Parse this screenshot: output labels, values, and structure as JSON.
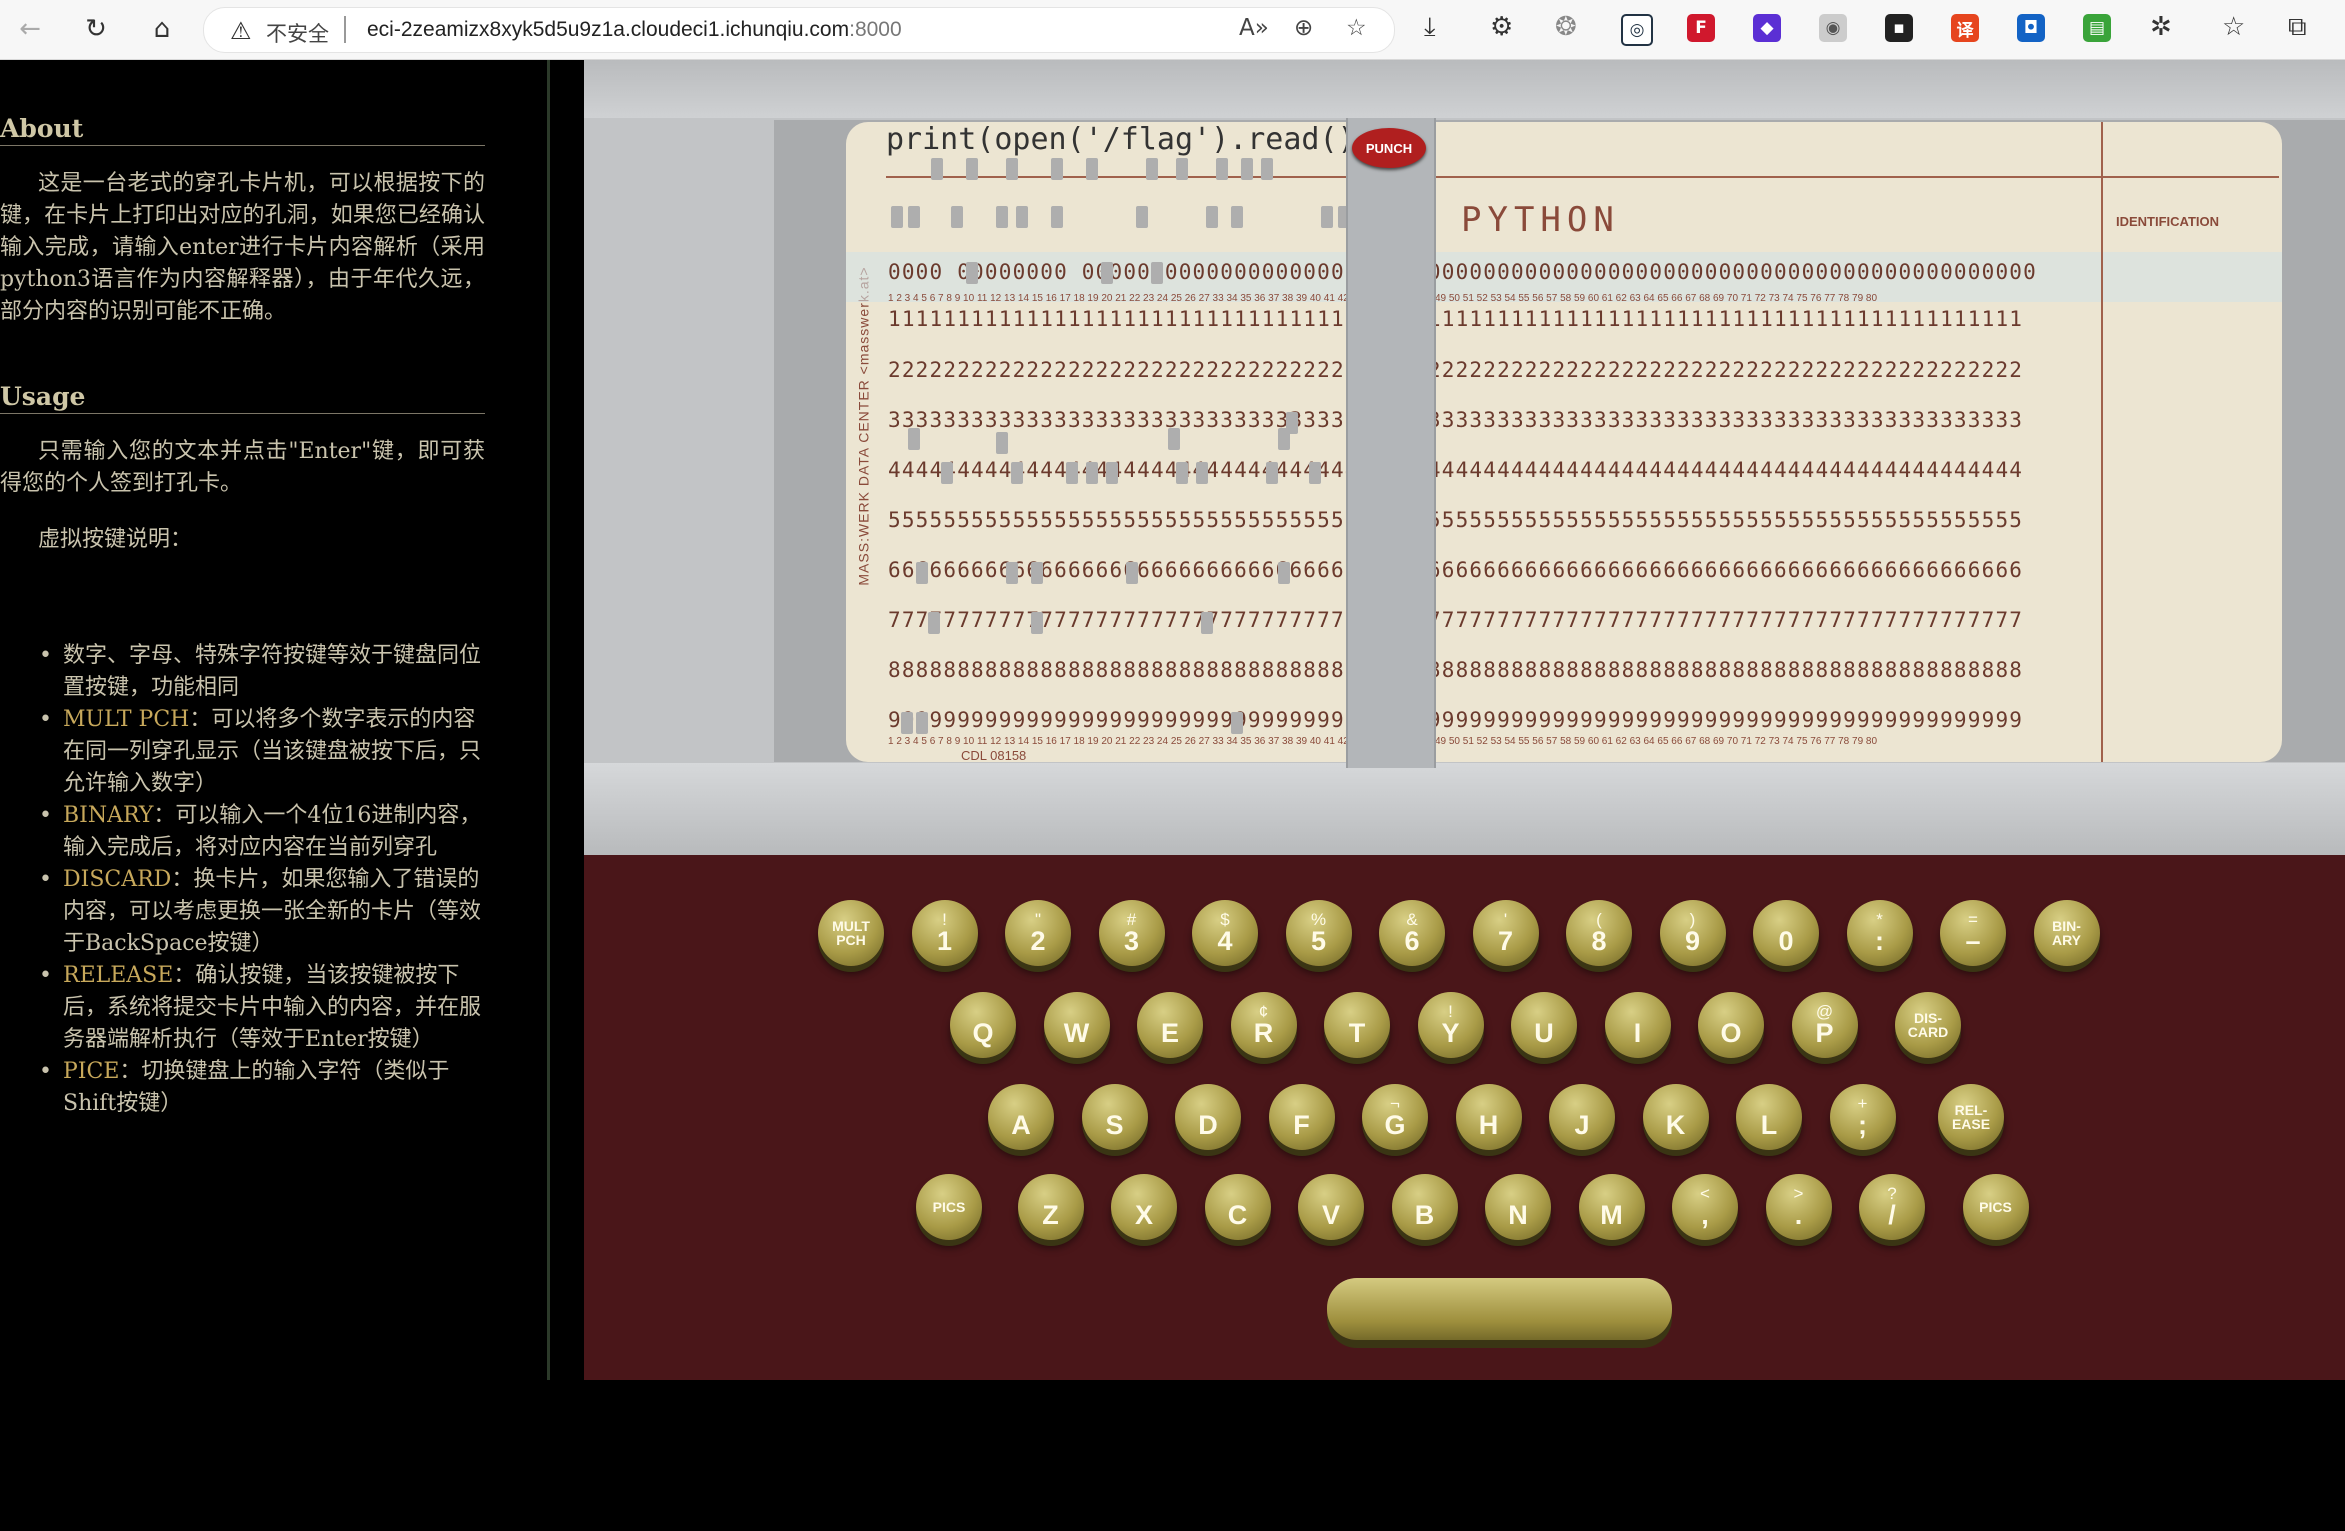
{
  "browser": {
    "security_label": "不安全",
    "url_host": "eci-2zeamizx8xyk5d5u9z1a.cloudeci1.ichunqiu.com",
    "url_port": ":8000",
    "icons": [
      "back-icon",
      "refresh-icon",
      "home-icon",
      "warning-icon",
      "read-aloud-icon",
      "zoom-icon",
      "favorite-add-icon",
      "download-icon",
      "extension-icon",
      "collections-icon",
      "favorites-icon",
      "split-screen-icon"
    ]
  },
  "sidebar": {
    "about_title": "About",
    "about_text": "这是一台老式的穿孔卡片机，可以根据按下的键，在卡片上打印出对应的孔洞，如果您已经确认输入完成，请输入enter进行卡片内容解析（采用python3语言作为内容解释器），由于年代久远，部分内容的识别可能不正确。",
    "usage_title": "Usage",
    "usage_text": "只需输入您的文本并点击\"Enter\"键，即可获得您的个人签到打孔卡。",
    "keys_intro": "虚拟按键说明：",
    "items": [
      {
        "keyword": "",
        "text": "数字、字母、特殊字符按键等效于键盘同位置按键，功能相同"
      },
      {
        "keyword": "MULT PCH",
        "text": "：可以将多个数字表示的内容在同一列穿孔显示（当该键盘被按下后，只允许输入数字）"
      },
      {
        "keyword": "BINARY",
        "text": "：可以输入一个4位16进制内容，输入完成后，将对应内容在当前列穿孔"
      },
      {
        "keyword": "DISCARD",
        "text": "：换卡片，如果您输入了错误的内容，可以考虑更换一张全新的卡片（等效于BackSpace按键）"
      },
      {
        "keyword": "RELEASE",
        "text": "：确认按键，当该按键被按下后，系统将提交卡片中输入的内容，并在服务器端解析执行（等效于Enter按键）"
      },
      {
        "keyword": "PICE",
        "text": "：切换键盘上的输入字符（类似于Shift按键）"
      }
    ]
  },
  "card": {
    "printed_text": "print(open('/flag').read())",
    "language_label": "PYTHON",
    "identification_label": "IDENTIFICATION",
    "side_label": "MASS:WERK DATA CENTER  <masswerk.at>",
    "footer_label": "CDL   08158",
    "punch_button": "PUNCH",
    "digit_rows": [
      "0000 00000000 000000000000000000000000000000000000000000000000000000000000000000000",
      "1111111111111111111111111111111111111111111111111111111111111111111111111111111111",
      "2222222222222222222222222222222222222222222222222222222222222222222222222222222222",
      "3333333333333333333333333333333333333333333333333333333333333333333333333333333333",
      "4444444444444444444444444444444444444444444444444444444444444444444444444444444444",
      "5555555555555555555555555555555555555555555555555555555555555555555555555555555555",
      "6666666666666666666666666666666666666666666666666666666666666666666666666666666666",
      "7777777777777777777777777777777777777777777777777777777777777777777777777777777777",
      "8888888888888888888888888888888888888888888888888888888888888888888888888888888888",
      "9999999999999999999999999999999999999999999999999999999999999999999999999999999999"
    ],
    "column_numbers": "1 2 3 4 5 6 7 8 9 10 11 12 13 14 15 16 17 18 19 20 21 22 23 24 25 26 27   33 34 35 36 37 38 39 40 41 42 43 44 45 46 47 48 49 50 51 52 53 54 55 56 57 58 59 60 61 62 63 64 65 66 67 68 69 70 71 72 73 74 75 76 77 78 79 80"
  },
  "keyboard": {
    "row1": [
      {
        "top": "MULT",
        "main": "PCH",
        "small": true
      },
      {
        "top": "!",
        "main": "1"
      },
      {
        "top": "\"",
        "main": "2"
      },
      {
        "top": "#",
        "main": "3"
      },
      {
        "top": "$",
        "main": "4"
      },
      {
        "top": "%",
        "main": "5"
      },
      {
        "top": "&",
        "main": "6"
      },
      {
        "top": "'",
        "main": "7"
      },
      {
        "top": "(",
        "main": "8"
      },
      {
        "top": ")",
        "main": "9"
      },
      {
        "top": "",
        "main": "0"
      },
      {
        "top": "*",
        "main": ":"
      },
      {
        "top": "=",
        "main": "–"
      },
      {
        "top": "BIN-",
        "main": "ARY",
        "small": true
      }
    ],
    "row2": [
      {
        "top": "",
        "main": "Q"
      },
      {
        "top": "",
        "main": "W"
      },
      {
        "top": "",
        "main": "E"
      },
      {
        "top": "¢",
        "main": "R"
      },
      {
        "top": "",
        "main": "T"
      },
      {
        "top": "!",
        "main": "Y"
      },
      {
        "top": "",
        "main": "U"
      },
      {
        "top": "",
        "main": "I"
      },
      {
        "top": "",
        "main": "O"
      },
      {
        "top": "@",
        "main": "P"
      },
      {
        "top": "DIS-",
        "main": "CARD",
        "small": true
      }
    ],
    "row3": [
      {
        "top": "",
        "main": "A"
      },
      {
        "top": "",
        "main": "S"
      },
      {
        "top": "",
        "main": "D"
      },
      {
        "top": "",
        "main": "F"
      },
      {
        "top": "¬",
        "main": "G"
      },
      {
        "top": "",
        "main": "H"
      },
      {
        "top": "",
        "main": "J"
      },
      {
        "top": "",
        "main": "K"
      },
      {
        "top": "",
        "main": "L"
      },
      {
        "top": "+",
        "main": ";"
      },
      {
        "top": "REL-",
        "main": "EASE",
        "small": true
      }
    ],
    "row4": [
      {
        "top": "",
        "main": "PICS",
        "small": true
      },
      {
        "top": "",
        "main": "Z"
      },
      {
        "top": "",
        "main": "X"
      },
      {
        "top": "",
        "main": "C"
      },
      {
        "top": "",
        "main": "V"
      },
      {
        "top": "",
        "main": "B"
      },
      {
        "top": "",
        "main": "N"
      },
      {
        "top": "",
        "main": "M"
      },
      {
        "top": "<",
        "main": ","
      },
      {
        "top": ">",
        "main": "."
      },
      {
        "top": "?",
        "main": "/"
      },
      {
        "top": "",
        "main": "PICS",
        "small": true
      }
    ]
  },
  "colors": {
    "keyboard_bg": "#4a1619",
    "key_gold": "#a99b47",
    "card": "#ece5d2",
    "highlight": "#c7a85b"
  }
}
